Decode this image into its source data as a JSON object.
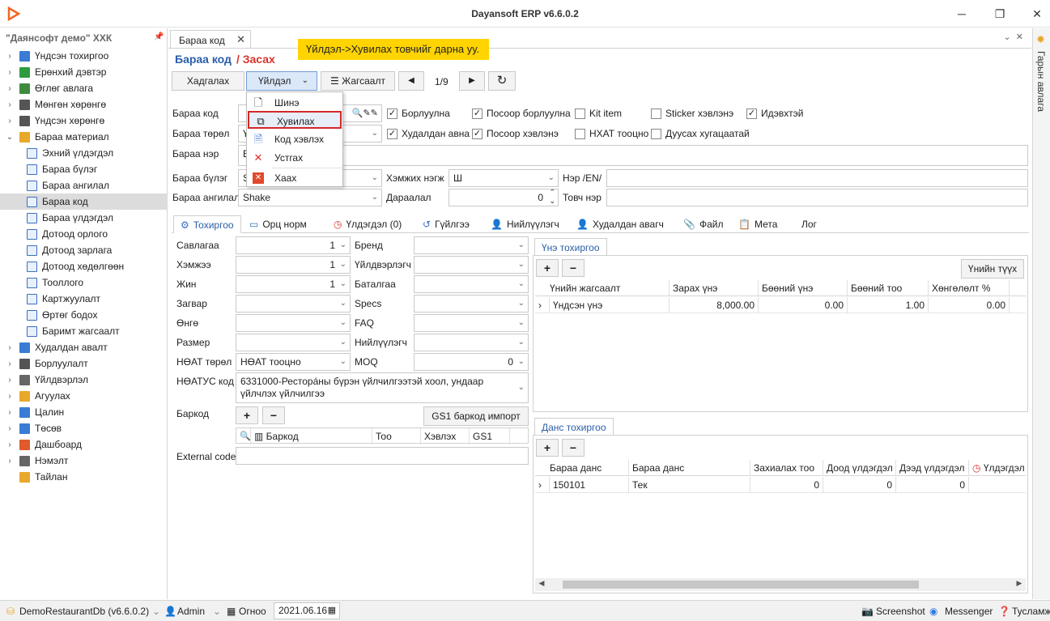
{
  "window": {
    "title": "Dayansoft ERP v6.6.0.2",
    "minimize": "─",
    "maximize": "❐",
    "close": "✕"
  },
  "sidebar": {
    "company": "\"Даянсофт демо\" ХХК",
    "items": [
      {
        "label": "Үндсэн тохиргоо",
        "arrow": "›",
        "color": "#3a7bd5"
      },
      {
        "label": "Ерөнхий дэвтэр",
        "arrow": "›",
        "color": "#2e9b3e"
      },
      {
        "label": "Өглөг авлага",
        "arrow": "›",
        "color": "#3d8b3d"
      },
      {
        "label": "Мөнгөн хөрөнгө",
        "arrow": "›",
        "color": "#555555"
      },
      {
        "label": "Үндсэн хөрөнгө",
        "arrow": "›",
        "color": "#555555"
      },
      {
        "label": "Бараа материал",
        "arrow": "⌄",
        "color": "#e8a82a"
      }
    ],
    "children": [
      "Эхний үлдэгдэл",
      "Бараа бүлэг",
      "Бараа ангилал",
      "Бараа код",
      "Бараа үлдэгдэл",
      "Дотоод орлого",
      "Дотоод зарлага",
      "Дотоод хөдөлгөөн",
      "Тооллого",
      "Картжуулалт",
      "Өртөг бодох",
      "Баримт жагсаалт"
    ],
    "items2": [
      {
        "label": "Худалдан авалт",
        "arrow": "›",
        "color": "#3a7bd5"
      },
      {
        "label": "Борлуулалт",
        "arrow": "›",
        "color": "#555555"
      },
      {
        "label": "Үйлдвэрлэл",
        "arrow": "›",
        "color": "#666666"
      },
      {
        "label": "Агуулах",
        "arrow": "›",
        "color": "#e8a82a"
      },
      {
        "label": "Цалин",
        "arrow": "›",
        "color": "#3a7bd5"
      },
      {
        "label": "Төсөв",
        "arrow": "›",
        "color": "#3a7bd5"
      },
      {
        "label": "Дашбоард",
        "arrow": "›",
        "color": "#e05a2a"
      },
      {
        "label": "Нэмэлт",
        "arrow": "›",
        "color": "#666666"
      },
      {
        "label": "Тайлан",
        "arrow": "",
        "color": "#e8a82a"
      }
    ]
  },
  "doc": {
    "tab": "Бараа код",
    "title": "Бараа код",
    "edit": "/ Засах",
    "tip": "Үйлдэл->Хувилах товчийг дарна уу."
  },
  "toolbar": {
    "save": "Хадгалах",
    "action": "Үйлдэл",
    "list": "Жагсаалт",
    "page": "1/9",
    "prev": "◀",
    "next": "▶",
    "refresh": "↻"
  },
  "menu": {
    "new": "Шинэ",
    "copy": "Хувилах",
    "print": "Код хэвлэх",
    "delete": "Устгах",
    "close": "Хаах"
  },
  "form": {
    "code_label": "Бараа код",
    "type_label": "Бараа төрөл",
    "type_value": "Ү",
    "name_label": "Бараа нэр",
    "name_value": "Б",
    "group_label": "Бараа бүлэг",
    "group_value": "S",
    "class_label": "Бараа ангилал",
    "class_value": "Shake",
    "unit_label": "Хэмжих нэгж",
    "unit_value": "Ш",
    "en_label": "Нэр /EN/",
    "order_label": "Дараалал",
    "order_value": "0",
    "short_label": "Товч нэр"
  },
  "checks": [
    {
      "label": "Борлуулна",
      "checked": "✓"
    },
    {
      "label": "Посоор борлуулна",
      "checked": "✓"
    },
    {
      "label": "Kit item",
      "checked": ""
    },
    {
      "label": "Sticker хэвлэнэ",
      "checked": ""
    },
    {
      "label": "Идэвхтэй",
      "checked": "✓"
    },
    {
      "label": "Худалдан авна",
      "checked": "✓"
    },
    {
      "label": "Посоор хэвлэнэ",
      "checked": "✓"
    },
    {
      "label": "НХАТ тооцно",
      "checked": ""
    },
    {
      "label": "Дуусах хугацаатай",
      "checked": ""
    }
  ],
  "subtabs": [
    "Тохиргоо",
    "Орц норм",
    "Үлдэгдэл (0)",
    "Гүйлгээ",
    "Нийлүүлэгч",
    "Худалдан авагч",
    "Файл",
    "Мета",
    "Лог"
  ],
  "settings": {
    "pack_label": "Савлагаа",
    "pack_value": "1",
    "size_label": "Хэмжээ",
    "size_value": "1",
    "weight_label": "Жин",
    "weight_value": "1",
    "model_label": "Загвар",
    "color_label": "Өнгө",
    "dim_label": "Размер",
    "vat_label": "НӨАТ төрөл",
    "vat_value": "НӨАТ тооцно",
    "vatcode_label": "НӨАТУС код",
    "vatcode_value": "6331000-Ресторáны бүрэн үйлчилгээтэй хоол, ундаар үйлчлэх үйлчилгээ",
    "brand_label": "Бренд",
    "maker_label": "Үйлдвэрлэгч",
    "guarantee_label": "Баталгаа",
    "specs_label": "Specs",
    "faq_label": "FAQ",
    "supplier_label": "Нийлүүлэгч",
    "moq_label": "MOQ",
    "moq_value": "0",
    "barcode_label": "Баркод",
    "gs1_btn": "GS1 баркод импорт",
    "bc_cols": [
      "Баркод",
      "Тоо",
      "Хэвлэх",
      "GS1"
    ],
    "ext_label": "External code"
  },
  "price": {
    "tab": "Үнэ тохиргоо",
    "history": "Үнийн түүх",
    "cols": [
      "Үнийн жагсаалт",
      "Зарах үнэ",
      "Бөөний үнэ",
      "Бөөний тоо",
      "Хөнгөлөлт %"
    ],
    "row": [
      "Үндсэн үнэ",
      "8,000.00",
      "0.00",
      "1.00",
      "0.00"
    ]
  },
  "account": {
    "tab": "Данс тохиргоо",
    "cols": [
      "Бараа данс",
      "Бараа данс",
      "Захиалах тоо",
      "Доод үлдэгдэл",
      "Дээд үлдэгдэл",
      "Үлдэгдэл"
    ],
    "row": [
      "150101",
      "Тек",
      "0",
      "0",
      "0",
      ""
    ]
  },
  "rightbar": {
    "label": "Гарын авлага"
  },
  "status": {
    "db": "DemoRestaurantDb (v6.6.0.2)",
    "user": "Admin",
    "period": "Огноо",
    "date": "2021.06.16",
    "screenshot": "Screenshot",
    "messenger": "Messenger",
    "help": "Тусламж"
  }
}
